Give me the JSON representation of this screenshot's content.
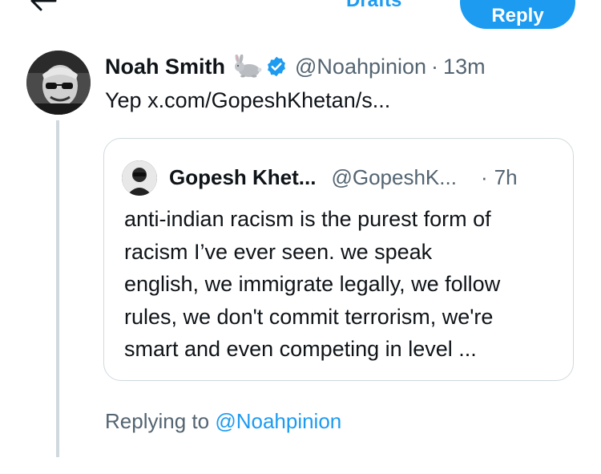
{
  "topbar": {
    "back_icon": "arrow-left-icon",
    "drafts_label": "Drafts",
    "reply_label": "Reply"
  },
  "tweet": {
    "author_name": "Noah Smith",
    "emoji_icon": "rabbit-emoji",
    "verified_icon": "verified-badge-icon",
    "handle": "@Noahpinion",
    "separator": "·",
    "time": "13m",
    "text": "Yep x.com/GopeshKhetan/s..."
  },
  "quote": {
    "author_name": "Gopesh Khet...",
    "handle": "@GopeshK...",
    "separator": "·",
    "time": "7h",
    "lines": [
      "anti-indian racism is the purest form of",
      "racism I’ve ever seen. we speak",
      "english, we immigrate legally, we follow",
      "rules, we don't commit terrorism, we're",
      "smart and even competing in level ..."
    ]
  },
  "replying": {
    "prefix": "Replying to ",
    "mention": "@Noahpinion"
  },
  "colors": {
    "accent": "#1d9bf0",
    "text": "#0f1419",
    "secondary": "#536471",
    "border": "#cfd9de"
  }
}
